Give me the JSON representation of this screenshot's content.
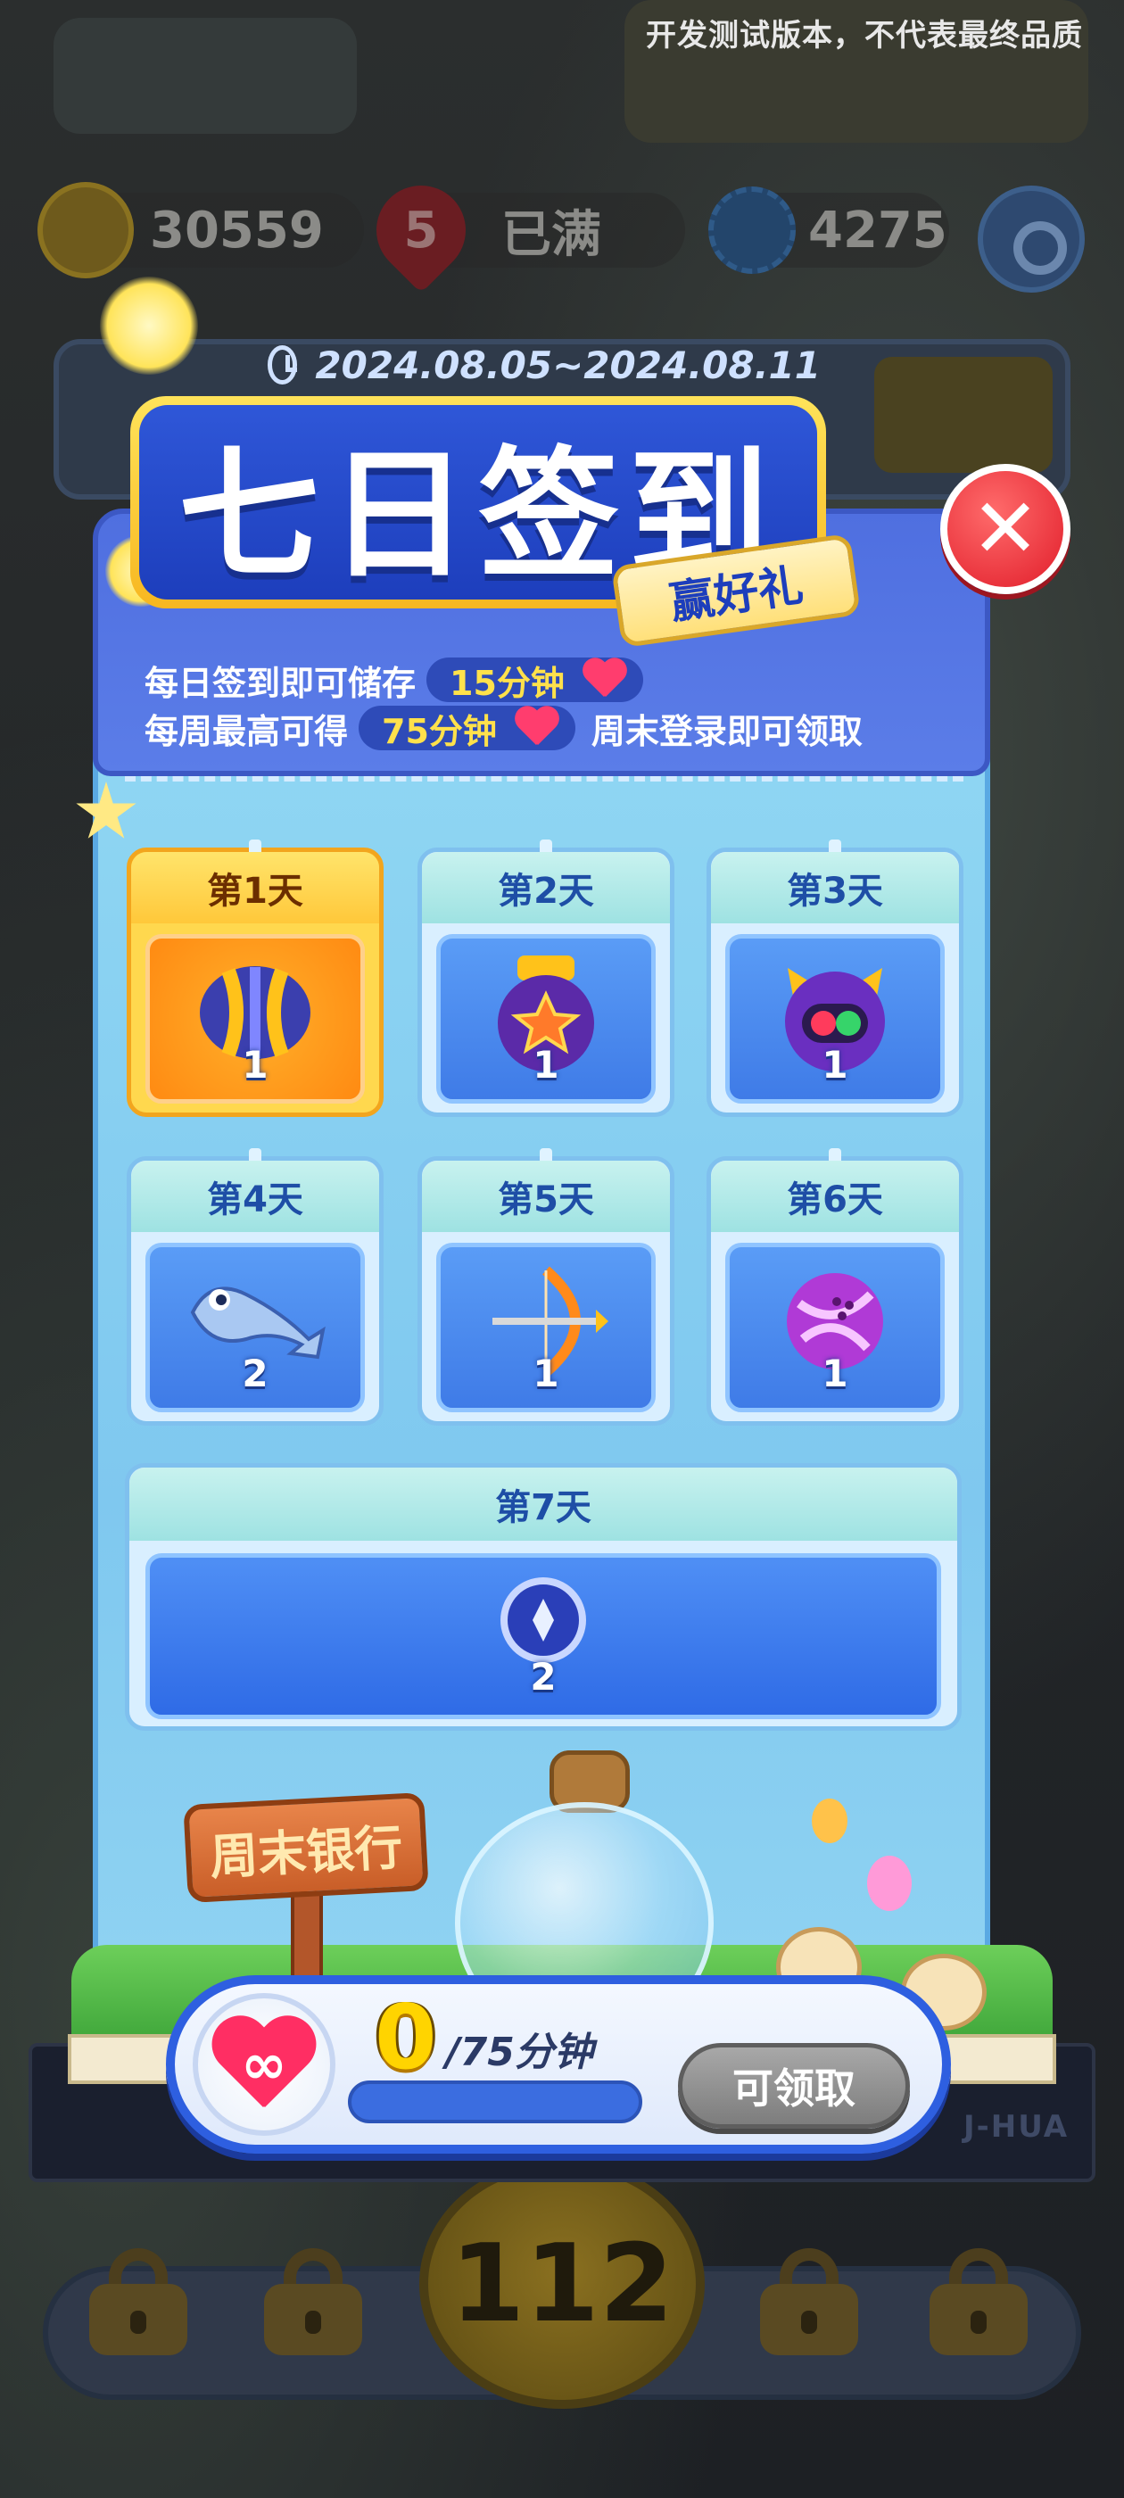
{
  "watermark": "开发测试版本，不代表最终品质",
  "top_bar": {
    "coins": "30559",
    "lives_count": "5",
    "lives_status": "已满",
    "caps": "4275"
  },
  "event": {
    "date_range": "2024.08.05~2024.08.11",
    "title": "七日签到",
    "subtitle": "赢好礼",
    "info1_prefix": "每日签到即可储存",
    "info1_value": "15分钟",
    "info2_prefix": "每周最高可得",
    "info2_value": "75分钟",
    "info2_suffix": "周末登录即可领取",
    "close_label": "✕"
  },
  "days": [
    {
      "label": "第1天",
      "count": "1",
      "item": "striped-ball",
      "active": true
    },
    {
      "label": "第2天",
      "count": "1",
      "item": "star-pot"
    },
    {
      "label": "第3天",
      "count": "1",
      "item": "cat-bomb"
    },
    {
      "label": "第4天",
      "count": "2",
      "item": "dolphin"
    },
    {
      "label": "第5天",
      "count": "1",
      "item": "bow-arrow"
    },
    {
      "label": "第6天",
      "count": "1",
      "item": "pink-ball"
    },
    {
      "label": "第7天",
      "count": "2",
      "item": "token-coin"
    }
  ],
  "bank": {
    "sign": "周末银行",
    "current": "0",
    "total": "/75分钟",
    "progress": 0,
    "claim_label": "可领取",
    "infinity": "∞"
  },
  "level": "112",
  "brand": "J-HUA",
  "colors": {
    "panel_blue": "#4f6fe0",
    "title_yellow": "#ffd84e",
    "heart_red": "#ff2e63",
    "close_red": "#e11d2a"
  }
}
